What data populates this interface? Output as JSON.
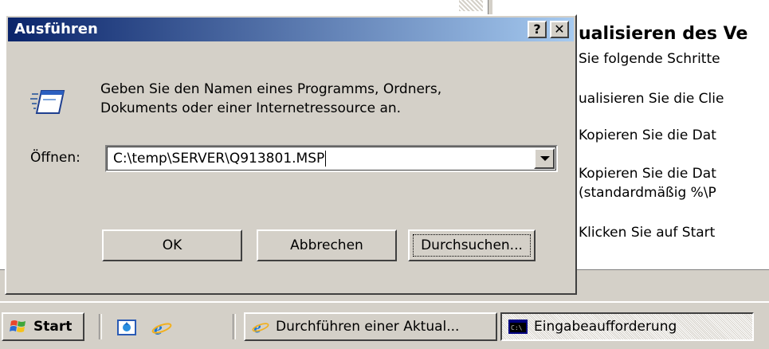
{
  "background_help": {
    "heading": "ualisieren des Ve",
    "lines": [
      "Sie folgende Schritte",
      "ualisieren Sie die Clie",
      "Kopieren Sie die Dat",
      "Kopieren Sie die Dat",
      "(standardmäßig %\\P",
      "Klicken Sie auf Start"
    ]
  },
  "dialog": {
    "title": "Ausführen",
    "help_button": "?",
    "close_button": "✕",
    "instruction": "Geben Sie den Namen eines Programms, Ordners, Dokuments oder einer Internetressource an.",
    "open_label": "Öffnen:",
    "open_value": "C:\\temp\\SERVER\\Q913801.MSP",
    "buttons": {
      "ok": "OK",
      "cancel": "Abbrechen",
      "browse": "Durchsuchen..."
    }
  },
  "taskbar": {
    "start_label": "Start",
    "tasks": [
      "Durchführen einer Aktual...",
      "Eingabeaufforderung"
    ]
  },
  "colors": {
    "titlebar_start": "#0a246a",
    "titlebar_end": "#a6caf0",
    "face": "#d4d0c8"
  }
}
